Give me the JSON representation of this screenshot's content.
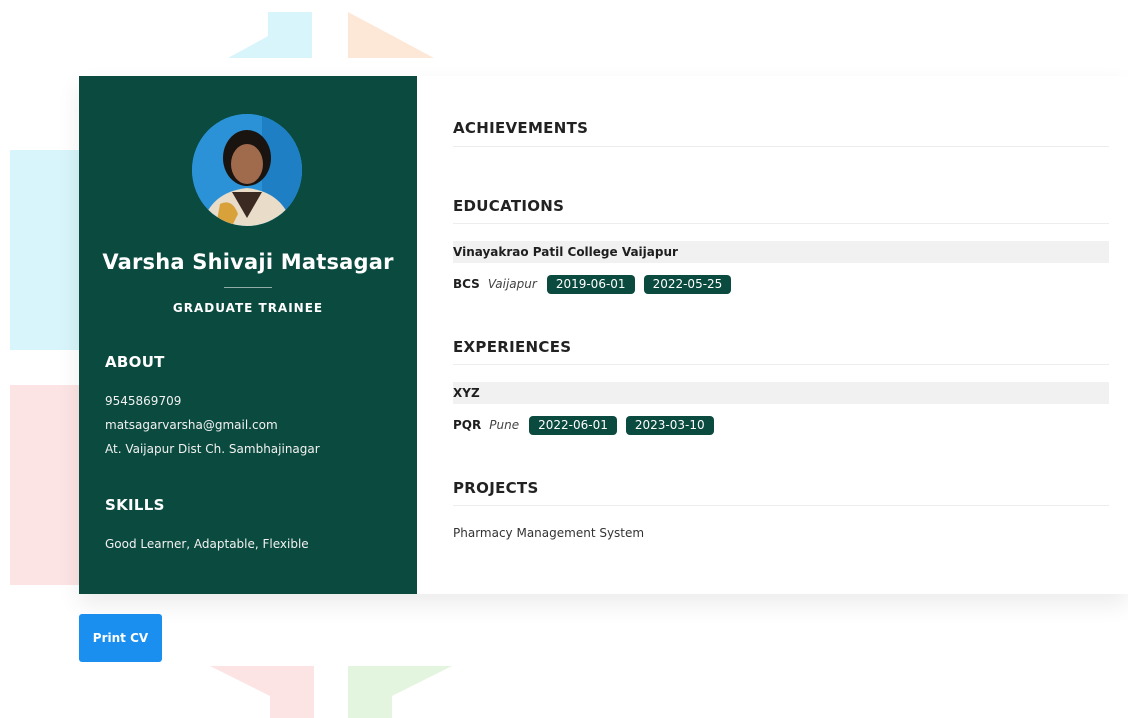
{
  "profile": {
    "name": "Varsha Shivaji Matsagar",
    "job_title": "GRADUATE TRAINEE",
    "avatar_icon": "profile-photo"
  },
  "about": {
    "heading": "ABOUT",
    "phone": "9545869709",
    "email": "matsagarvarsha@gmail.com",
    "address": "At. Vaijapur Dist Ch. Sambhajinagar"
  },
  "skills": {
    "heading": "SKILLS",
    "text": "Good Learner, Adaptable, Flexible"
  },
  "achievements": {
    "heading": "ACHIEVEMENTS"
  },
  "educations": {
    "heading": "EDUCATIONS",
    "items": [
      {
        "institution": "Vinayakrao Patil College Vaijapur",
        "degree": "BCS",
        "location": "Vaijapur",
        "start_date": "2019-06-01",
        "end_date": "2022-05-25"
      }
    ]
  },
  "experiences": {
    "heading": "EXPERIENCES",
    "items": [
      {
        "company": "XYZ",
        "role": "PQR",
        "location": "Pune",
        "start_date": "2022-06-01",
        "end_date": "2023-03-10"
      }
    ]
  },
  "projects": {
    "heading": "PROJECTS",
    "items": [
      "Pharmacy Management System"
    ]
  },
  "actions": {
    "print_label": "Print CV"
  },
  "colors": {
    "sidebar": "#0a4a3f",
    "badge": "#0a4a3f",
    "print_button": "#1b8ff0"
  }
}
